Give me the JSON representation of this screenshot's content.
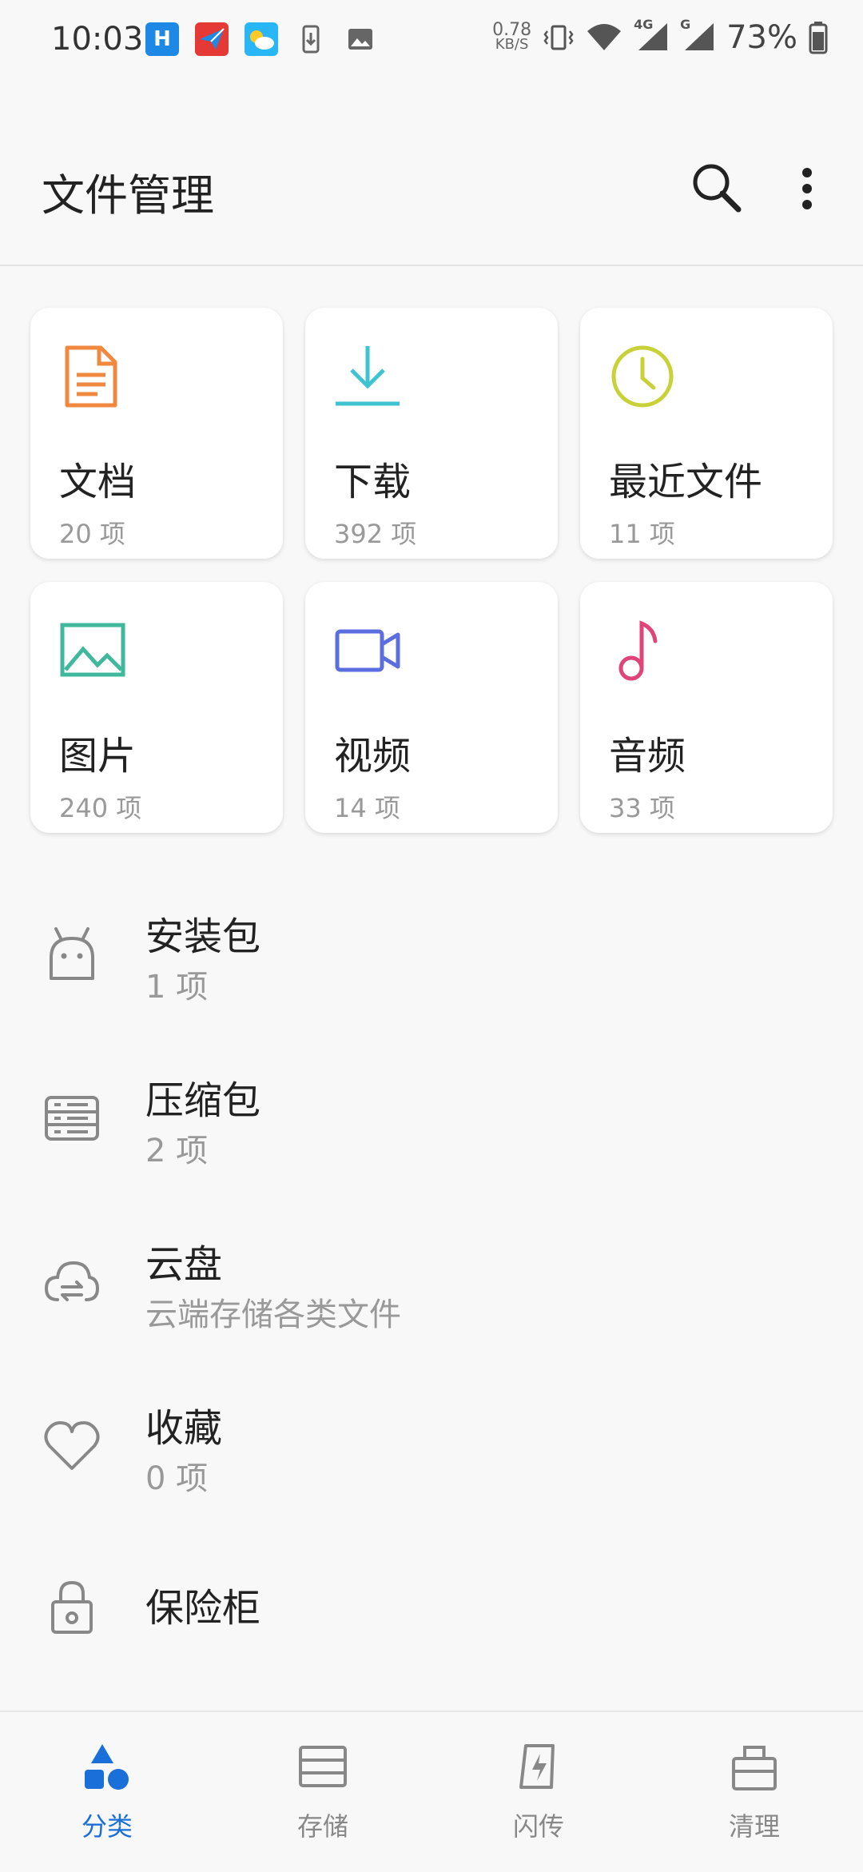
{
  "status_bar": {
    "time": "10:03",
    "speed_value": "0.78",
    "speed_unit": "KB/S",
    "net_4g": "4G",
    "net_g": "G",
    "battery": "73%",
    "notification_icons": [
      "huawei-h-icon",
      "mail-app-icon",
      "weather-icon",
      "download-icon",
      "image-icon"
    ]
  },
  "app_bar": {
    "title": "文件管理",
    "search_icon": "search-icon",
    "more_icon": "more-vert-icon"
  },
  "categories": [
    {
      "title": "文档",
      "count": "20 项",
      "icon": "document-icon",
      "color": "#f0893f"
    },
    {
      "title": "下载",
      "count": "392 项",
      "icon": "download-icon",
      "color": "#3fc3d1"
    },
    {
      "title": "最近文件",
      "count": "11 项",
      "icon": "clock-icon",
      "color": "#c9d138"
    },
    {
      "title": "图片",
      "count": "240 项",
      "icon": "image-icon",
      "color": "#3fb89b"
    },
    {
      "title": "视频",
      "count": "14 项",
      "icon": "video-icon",
      "color": "#5b6ee0"
    },
    {
      "title": "音频",
      "count": "33 项",
      "icon": "music-icon",
      "color": "#e0457a"
    }
  ],
  "list": [
    {
      "title": "安装包",
      "sub": "1 项",
      "icon": "android-icon"
    },
    {
      "title": "压缩包",
      "sub": "2 项",
      "icon": "archive-icon"
    },
    {
      "title": "云盘",
      "sub": "云端存储各类文件",
      "icon": "cloud-icon"
    },
    {
      "title": "收藏",
      "sub": "0 项",
      "icon": "heart-icon"
    },
    {
      "title": "保险柜",
      "sub": "",
      "icon": "lock-icon"
    }
  ],
  "bottom_nav": [
    {
      "label": "分类",
      "icon": "category-icon",
      "active": true
    },
    {
      "label": "存储",
      "icon": "storage-icon",
      "active": false
    },
    {
      "label": "闪传",
      "icon": "flash-transfer-icon",
      "active": false
    },
    {
      "label": "清理",
      "icon": "clean-icon",
      "active": false
    }
  ],
  "colors": {
    "accent": "#1a6fd8",
    "icon_gray": "#888888",
    "background": "#f8f8f8"
  }
}
